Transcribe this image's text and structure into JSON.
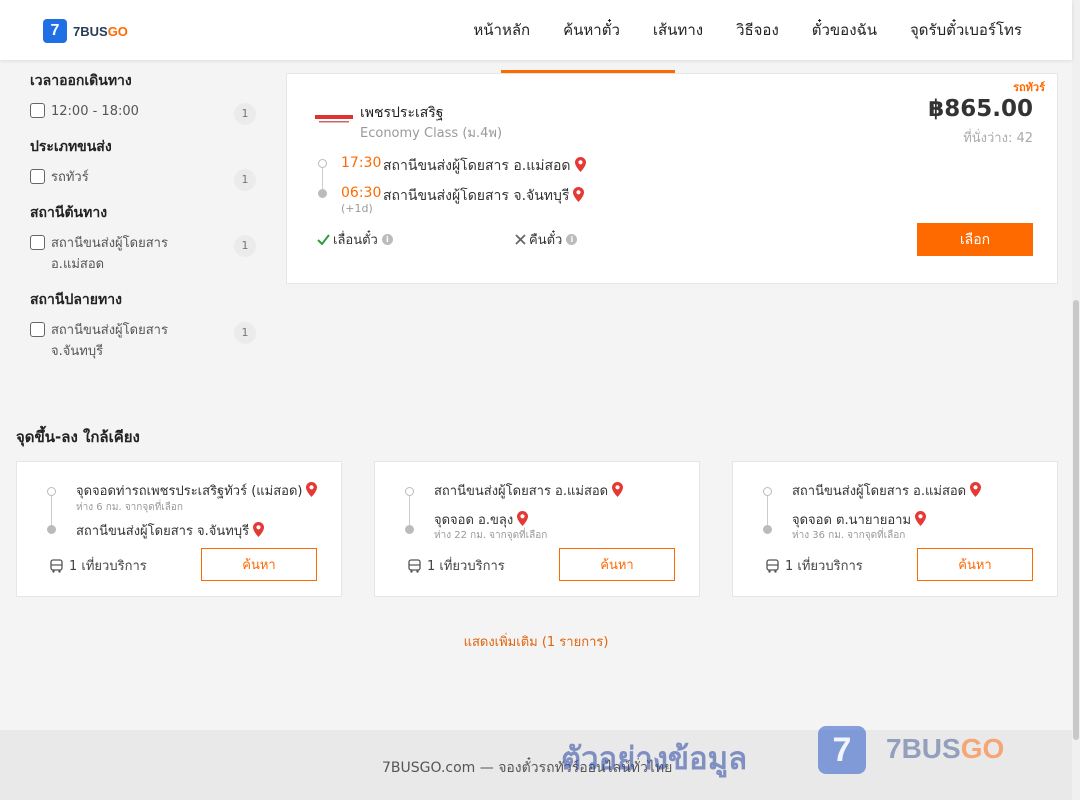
{
  "header": {
    "logo_number": "7",
    "logo_brand": "7BUS",
    "logo_brand_accent": "GO",
    "nav": [
      "หน้าหลัก",
      "ค้นหาตั๋ว",
      "เส้นทาง",
      "วิธีจอง",
      "ตั๋วของฉัน",
      "จุดรับตั๋วเบอร์โทร"
    ]
  },
  "filters": [
    {
      "title": "เวลาออกเดินทาง",
      "options": [
        {
          "label": "12:00 - 18:00",
          "count": "1"
        }
      ]
    },
    {
      "title": "ประเภทขนส่ง",
      "options": [
        {
          "label": "รถทัวร์",
          "count": "1"
        }
      ]
    },
    {
      "title": "สถานีต้นทาง",
      "options": [
        {
          "label": "สถานีขนส่งผู้โดยสาร อ.แม่สอด",
          "count": "1"
        }
      ]
    },
    {
      "title": "สถานีปลายทาง",
      "options": [
        {
          "label": "สถานีขนส่งผู้โดยสาร จ.จันทบุรี",
          "count": "1"
        }
      ]
    }
  ],
  "trip": {
    "tag": "รถทัวร์",
    "operator": "เพชรประเสริฐ",
    "class": "Economy Class (ม.4พ)",
    "price": "฿865.00",
    "seats": "ที่นั่งว่าง: 42",
    "depart_time": "17:30",
    "depart_stop": "สถานีขนส่งผู้โดยสาร อ.แม่สอด",
    "arrive_time": "06:30",
    "arrive_stop": "สถานีขนส่งผู้โดยสาร จ.จันทบุรี",
    "plus_day": "(+1d)",
    "reschedule": "เลื่อนตั๋ว",
    "refund": "คืนตั๋ว",
    "select_label": "เลือก"
  },
  "nearby": {
    "title": "จุดขึ้น-ลง ใกล้เคียง",
    "cards": [
      {
        "from": "จุดจอดท่ารถเพชรประเสริฐทัวร์ (แม่สอด)",
        "from_dist": "ห่าง 6 กม. จากจุดที่เลือก",
        "to": "สถานีขนส่งผู้โดยสาร จ.จันทบุรี",
        "to_dist": "",
        "service": "1 เที่ยวบริการ",
        "button": "ค้นหา"
      },
      {
        "from": "สถานีขนส่งผู้โดยสาร อ.แม่สอด",
        "from_dist": "",
        "to": "จุดจอด อ.ขลุง",
        "to_dist": "ห่าง 22 กม. จากจุดที่เลือก",
        "service": "1 เที่ยวบริการ",
        "button": "ค้นหา"
      },
      {
        "from": "สถานีขนส่งผู้โดยสาร อ.แม่สอด",
        "from_dist": "",
        "to": "จุดจอด ต.นายายอาม",
        "to_dist": "ห่าง 36 กม. จากจุดที่เลือก",
        "service": "1 เที่ยวบริการ",
        "button": "ค้นหา"
      }
    ]
  },
  "show_more": "แสดงเพิ่มเติม (1 รายการ)",
  "footer": {
    "text": "7BUSGO.com — จองตั๋วรถทัวร์ออนไลน์ทั่วไทย"
  },
  "watermark": {
    "text": "ตัวอย่างข้อมูล",
    "logo_number": "7",
    "brand": "7BUS",
    "brand_accent": "GO"
  },
  "colors": {
    "accent": "#ff6a00",
    "brand_blue": "#1f6fe5",
    "pin": "#e53935",
    "check": "#2e9e3e"
  }
}
